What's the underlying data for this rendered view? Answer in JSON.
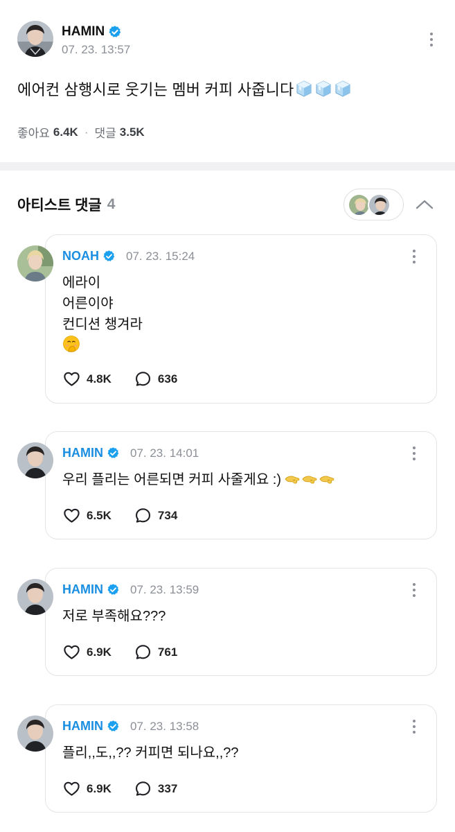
{
  "post": {
    "author": "HAMIN",
    "timestamp": "07. 23. 13:57",
    "text": "에어컨 삼행시로 웃기는 멤버 커피 사줍니다",
    "emoji": "ice-cube-emoji x3",
    "likes_label": "좋아요",
    "likes_count": "6.4K",
    "separator": "·",
    "comments_label": "댓글",
    "comments_count": "3.5K"
  },
  "artist_comments": {
    "title": "아티스트 댓글",
    "count": "4",
    "items": [
      {
        "author": "NOAH",
        "timestamp": "07. 23. 15:24",
        "lines": [
          "에라이",
          "어른이야",
          "컨디션 챙겨라"
        ],
        "emoji": "face-with-hand-over-mouth-emoji",
        "likes": "4.8K",
        "replies": "636"
      },
      {
        "author": "HAMIN",
        "timestamp": "07. 23. 14:01",
        "lines": [
          "우리 플리는 어른되면 커피 사줄게요 :)"
        ],
        "emoji": "pinching-hand-emoji x3",
        "likes": "6.5K",
        "replies": "734"
      },
      {
        "author": "HAMIN",
        "timestamp": "07. 23. 13:59",
        "lines": [
          "저로 부족해요???"
        ],
        "likes": "6.9K",
        "replies": "761"
      },
      {
        "author": "HAMIN",
        "timestamp": "07. 23. 13:58",
        "lines": [
          "플리,,도,,?? 커피면 되나요,,??"
        ],
        "likes": "6.9K",
        "replies": "337"
      }
    ]
  },
  "colors": {
    "artist_name": "#1a8ee0",
    "verified_badge": "#1aa0ee",
    "muted_text": "#8b8f96",
    "card_border": "#e3e4e8",
    "section_band": "#f1f1f3"
  }
}
